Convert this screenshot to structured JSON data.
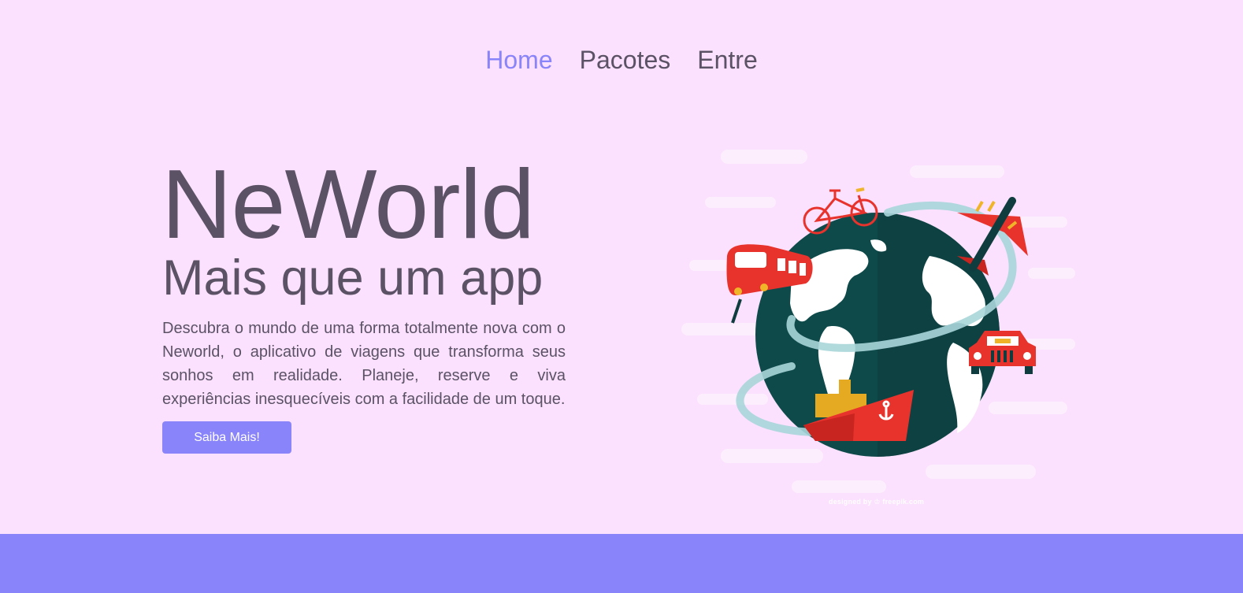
{
  "nav": {
    "items": [
      {
        "label": "Home",
        "active": true
      },
      {
        "label": "Pacotes",
        "active": false
      },
      {
        "label": "Entre",
        "active": false
      }
    ]
  },
  "hero": {
    "title": "NeWorld",
    "subtitle": "Mais que um app",
    "description": "Descubra o mundo de uma forma totalmente nova com o Neworld, o aplicativo de viagens que transforma seus sonhos em realidade. Planeje, reserve e viva experiências inesquecíveis com a facilidade de um toque.",
    "cta_label": "Saiba Mais!"
  },
  "illustration": {
    "subject": "globe-with-transport-icons",
    "credit": "designed by ♔ freepik.com"
  },
  "colors": {
    "background": "#fbe1fd",
    "accent": "#8a84fa",
    "text": "#5b5266"
  }
}
